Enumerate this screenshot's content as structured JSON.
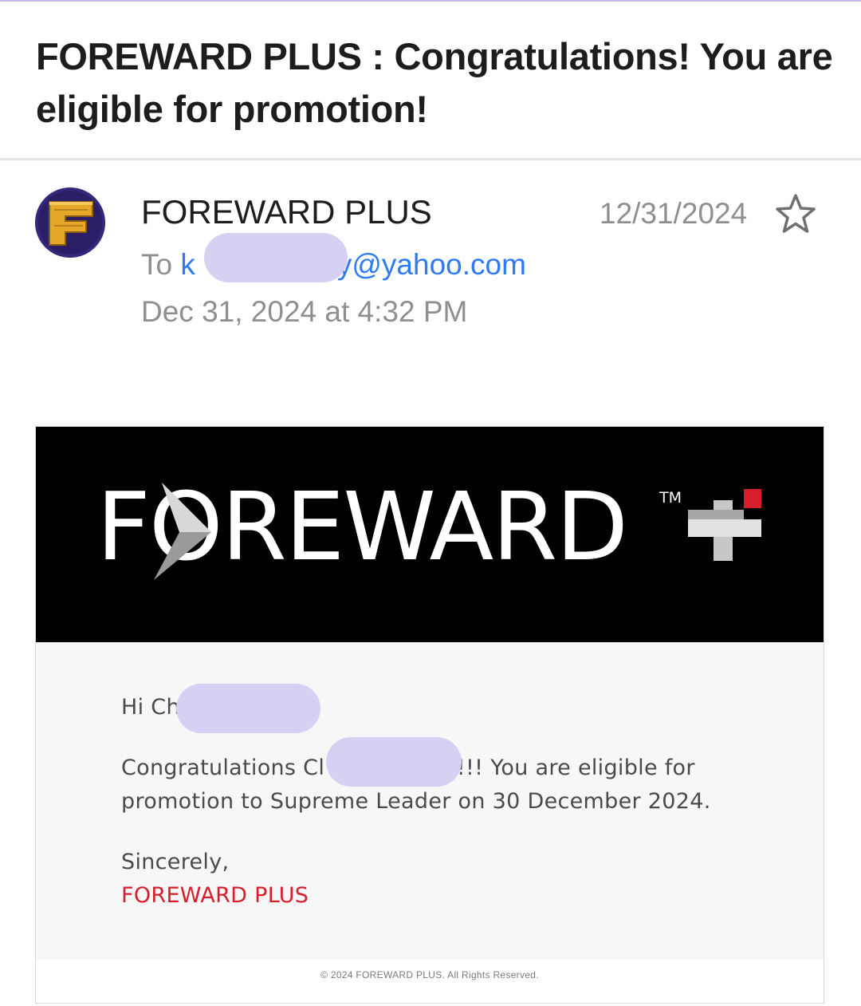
{
  "email": {
    "subject": "FOREWARD PLUS : Congratulations! You are eligible for promotion!",
    "sender_name": "FOREWARD PLUS",
    "to_prefix": "To",
    "to_visible_start": "k",
    "to_visible_end": "y@yahoo.com",
    "received_full": "Dec 31, 2024 at 4:32 PM",
    "received_short": "12/31/2024",
    "star_icon": "star-outline-icon",
    "avatar_letter": "F"
  },
  "message": {
    "brand_logo_text": "FOREWARD",
    "brand_logo_tm": "TM",
    "greeting_visible": "Hi Ch",
    "congrats_start": "Congratulations Cl",
    "congrats_end": "e !!! You are eligible for",
    "congrats_line2": "promotion to Supreme Leader on 30 December 2024.",
    "signoff": "Sincerely,",
    "signoff_brand": "FOREWARD PLUS",
    "footer": "© 2024 FOREWARD PLUS. All Rights Reserved."
  },
  "colors": {
    "accent_link": "#2f7bf5",
    "brand_red": "#d51f2a",
    "redaction": "#d6d0f2",
    "banner_bg": "#000000"
  }
}
